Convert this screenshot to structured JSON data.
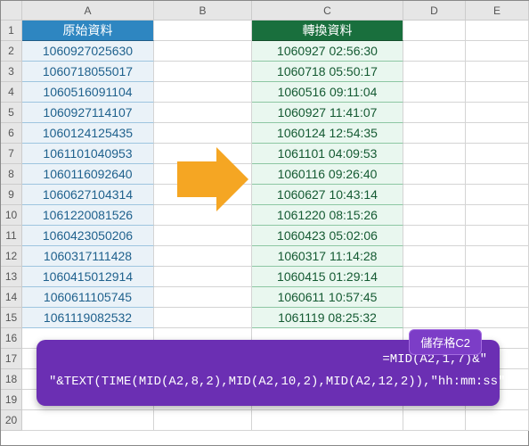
{
  "columns": [
    "A",
    "B",
    "C",
    "D",
    "E"
  ],
  "headers": {
    "a": "原始資料",
    "c": "轉換資料"
  },
  "rows": [
    {
      "a": "1060927025630",
      "c": "1060927 02:56:30"
    },
    {
      "a": "1060718055017",
      "c": "1060718 05:50:17"
    },
    {
      "a": "1060516091104",
      "c": "1060516 09:11:04"
    },
    {
      "a": "1060927114107",
      "c": "1060927 11:41:07"
    },
    {
      "a": "1060124125435",
      "c": "1060124 12:54:35"
    },
    {
      "a": "1061101040953",
      "c": "1061101 04:09:53"
    },
    {
      "a": "1060116092640",
      "c": "1060116 09:26:40"
    },
    {
      "a": "1060627104314",
      "c": "1060627 10:43:14"
    },
    {
      "a": "1061220081526",
      "c": "1061220 08:15:26"
    },
    {
      "a": "1060423050206",
      "c": "1060423 05:02:06"
    },
    {
      "a": "1060317111428",
      "c": "1060317 11:14:28"
    },
    {
      "a": "1060415012914",
      "c": "1060415 01:29:14"
    },
    {
      "a": "1060611105745",
      "c": "1060611 10:57:45"
    },
    {
      "a": "1061119082532",
      "c": "1061119 08:25:32"
    }
  ],
  "formula": {
    "label": "儲存格C2",
    "line1": "=MID(A2,1,7)&\" ",
    "line2": "\"&TEXT(TIME(MID(A2,8,2),MID(A2,10,2),MID(A2,12,2)),\"hh:mm:ss\")"
  }
}
